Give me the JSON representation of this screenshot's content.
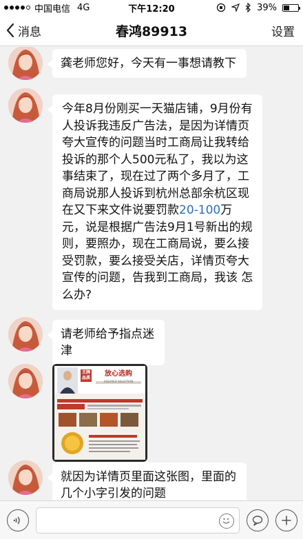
{
  "status_bar": {
    "carrier": "中国电信",
    "network": "4G",
    "time": "下午12:20",
    "battery": "39%",
    "battery_level": 0.39
  },
  "nav": {
    "back_label": "消息",
    "title": "春鸿89913",
    "settings_label": "设置"
  },
  "messages": [
    {
      "type": "text",
      "text": "龚老师您好，今天有一事想请教下"
    },
    {
      "type": "text",
      "text_before": "今年8月份刚买一天猫店铺，9月份有人投诉我违反广告法，是因为详情页夸大宣传的问题当时工商局让我转给投诉的那个人500元私了，我以为这事结束了，现在过了两个多月了，工商局说那人投诉到杭州总部余杭区现在又下来文件说要罚款",
      "highlight": "20-100",
      "text_after": "万元，说是根据广告法9月1号新出的规则，要照办，现在工商局说，要么接受罚款，要么接受关店，详情页夸大宣传的问题，告我到工商局，我该 怎么办?"
    },
    {
      "type": "text",
      "text": "请老师给予指点迷津"
    },
    {
      "type": "image",
      "badge_top": "王牌",
      "badge_bottom": "品质",
      "headline": "放心选购",
      "subhead": "ASSURED SELECTION"
    },
    {
      "type": "text",
      "text": "就因为详情页里面这张图，里面的几个小字引发的问题"
    }
  ]
}
